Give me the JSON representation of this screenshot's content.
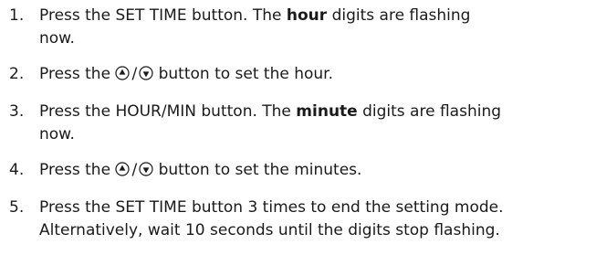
{
  "steps": [
    {
      "number": "1.",
      "line1_a": "Press the SET TIME button. The ",
      "line1_bold": "hour",
      "line1_b": " digits are flashing",
      "line2": "now."
    },
    {
      "number": "2.",
      "pre": "Press the",
      "slash": "/",
      "post": "button to set the hour."
    },
    {
      "number": "3.",
      "line1_a": "Press the HOUR/MIN button. The ",
      "line1_bold": "minute",
      "line1_b": " digits are flashing",
      "line2": "now."
    },
    {
      "number": "4.",
      "pre": "Press the",
      "slash": "/",
      "post": "button to set the minutes."
    },
    {
      "number": "5.",
      "line1": "Press the SET TIME button 3 times to end the setting mode.",
      "line2": "Alternatively, wait 10 seconds until the digits stop flashing."
    }
  ],
  "icons": {
    "up": "up-arrow-circle-icon",
    "down": "down-arrow-circle-icon"
  }
}
